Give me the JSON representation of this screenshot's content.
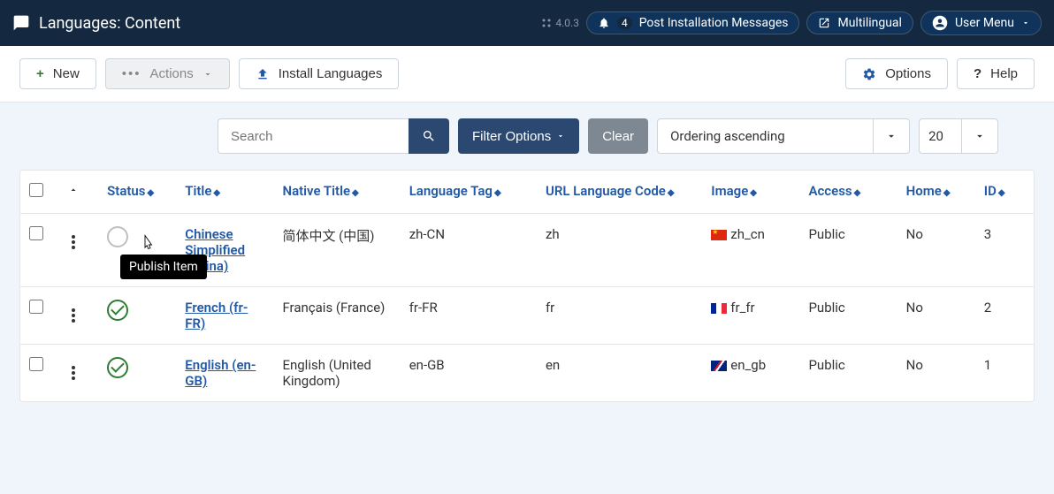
{
  "topbar": {
    "title": "Languages: Content",
    "version": "4.0.3",
    "notif_count": "4",
    "pim_label": "Post Installation Messages",
    "multilingual_label": "Multilingual",
    "usermenu_label": "User Menu"
  },
  "toolbar": {
    "new_label": "New",
    "actions_label": "Actions",
    "install_label": "Install Languages",
    "options_label": "Options",
    "help_label": "Help"
  },
  "filter": {
    "search_placeholder": "Search",
    "filter_options_label": "Filter Options",
    "clear_label": "Clear",
    "ordering_label": "Ordering ascending",
    "limit": "20"
  },
  "columns": {
    "status": "Status",
    "title": "Title",
    "native_title": "Native Title",
    "lang_tag": "Language Tag",
    "url_code": "URL Language Code",
    "image": "Image",
    "access": "Access",
    "home": "Home",
    "id": "ID"
  },
  "tooltip": "Publish Item",
  "rows": [
    {
      "title": "Chinese Simplified (China)",
      "native": "简体中文 (中国)",
      "tag": "zh-CN",
      "url": "zh",
      "image": "zh_cn",
      "access": "Public",
      "home": "No",
      "id": "3",
      "published": false,
      "flag_class": "flag-cn"
    },
    {
      "title": "French (fr-FR)",
      "native": "Français (France)",
      "tag": "fr-FR",
      "url": "fr",
      "image": "fr_fr",
      "access": "Public",
      "home": "No",
      "id": "2",
      "published": true,
      "flag_class": "flag-fr"
    },
    {
      "title": "English (en-GB)",
      "native": "English (United Kingdom)",
      "tag": "en-GB",
      "url": "en",
      "image": "en_gb",
      "access": "Public",
      "home": "No",
      "id": "1",
      "published": true,
      "flag_class": "flag-gb"
    }
  ]
}
